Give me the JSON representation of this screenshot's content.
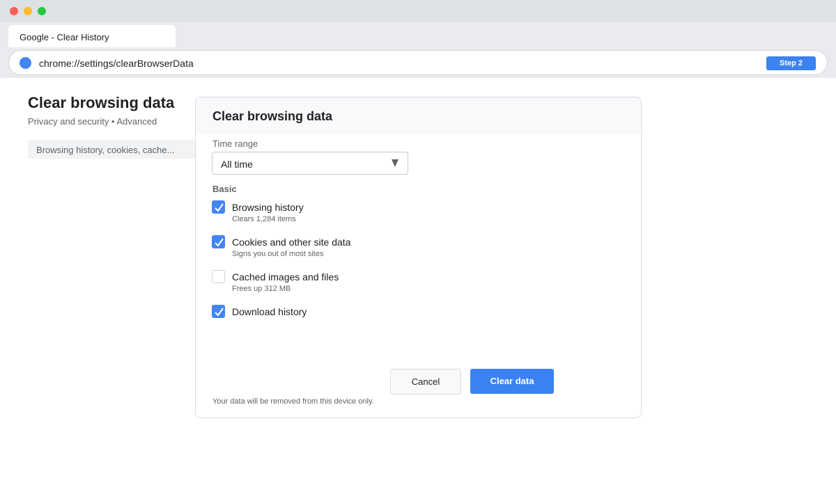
{
  "browser": {
    "tab_title": "Google - Clear History",
    "url": "chrome://settings/clearBrowserData",
    "step_badge": "Step 2"
  },
  "page": {
    "title": "Clear browsing data",
    "breadcrumb": "Privacy and security • Advanced",
    "search_text": "Browsing history, cookies, cache..."
  },
  "dialog": {
    "title": "Clear browsing data",
    "time_range_label": "Time range",
    "time_range_value": "All time",
    "section_label": "Basic",
    "options": [
      {
        "label": "Browsing history",
        "sub": "Clears 1,284 items",
        "checked": true
      },
      {
        "label": "Cookies and other site data",
        "sub": "Signs you out of most sites",
        "checked": true
      },
      {
        "label": "Cached images and files",
        "sub": "Frees up 312 MB",
        "checked": false
      },
      {
        "label": "Download history",
        "sub": "",
        "checked": true
      }
    ],
    "cancel_label": "Cancel",
    "clear_label": "Clear data",
    "footer_note": "Your data will be removed from this device only."
  },
  "colors": {
    "accent": "#3c82f0",
    "checkbox": "#4285f4"
  }
}
